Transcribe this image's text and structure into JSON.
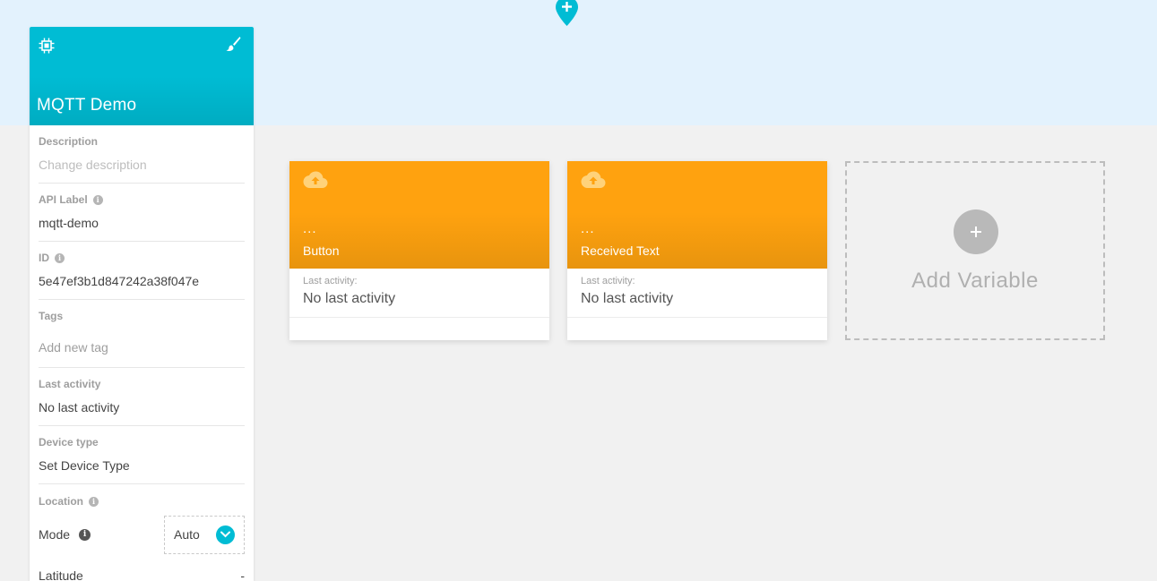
{
  "device": {
    "name": "MQTT Demo",
    "description_label": "Description",
    "description_placeholder": "Change description",
    "api_label_label": "API Label",
    "api_label_value": "mqtt-demo",
    "id_label": "ID",
    "id_value": "5e47ef3b1d847242a38f047e",
    "tags_label": "Tags",
    "tags_placeholder": "Add new tag",
    "last_activity_label": "Last activity",
    "last_activity_value": "No last activity",
    "device_type_label": "Device type",
    "device_type_value": "Set Device Type",
    "location_label": "Location",
    "mode_label": "Mode",
    "mode_value": "Auto",
    "latitude_label": "Latitude",
    "latitude_value": "-"
  },
  "variables": [
    {
      "value": "...",
      "name": "Button",
      "last_activity_label": "Last activity:",
      "last_activity_value": "No last activity"
    },
    {
      "value": "...",
      "name": "Received Text",
      "last_activity_label": "Last activity:",
      "last_activity_value": "No last activity"
    }
  ],
  "add_variable": {
    "label": "Add Variable"
  },
  "icons": {
    "map_pin": "map-pin-add-icon",
    "device": "chip-icon",
    "edit_appearance": "paint-brush-icon",
    "variable": "cloud-upload-icon",
    "info": "info-icon",
    "dropdown": "chevron-down-icon",
    "add": "plus-icon"
  },
  "colors": {
    "device_header": "#00bcd4",
    "variable_header": "#ffa20f",
    "map_background": "#e3f2fd",
    "page_background": "#f1f1f1"
  }
}
